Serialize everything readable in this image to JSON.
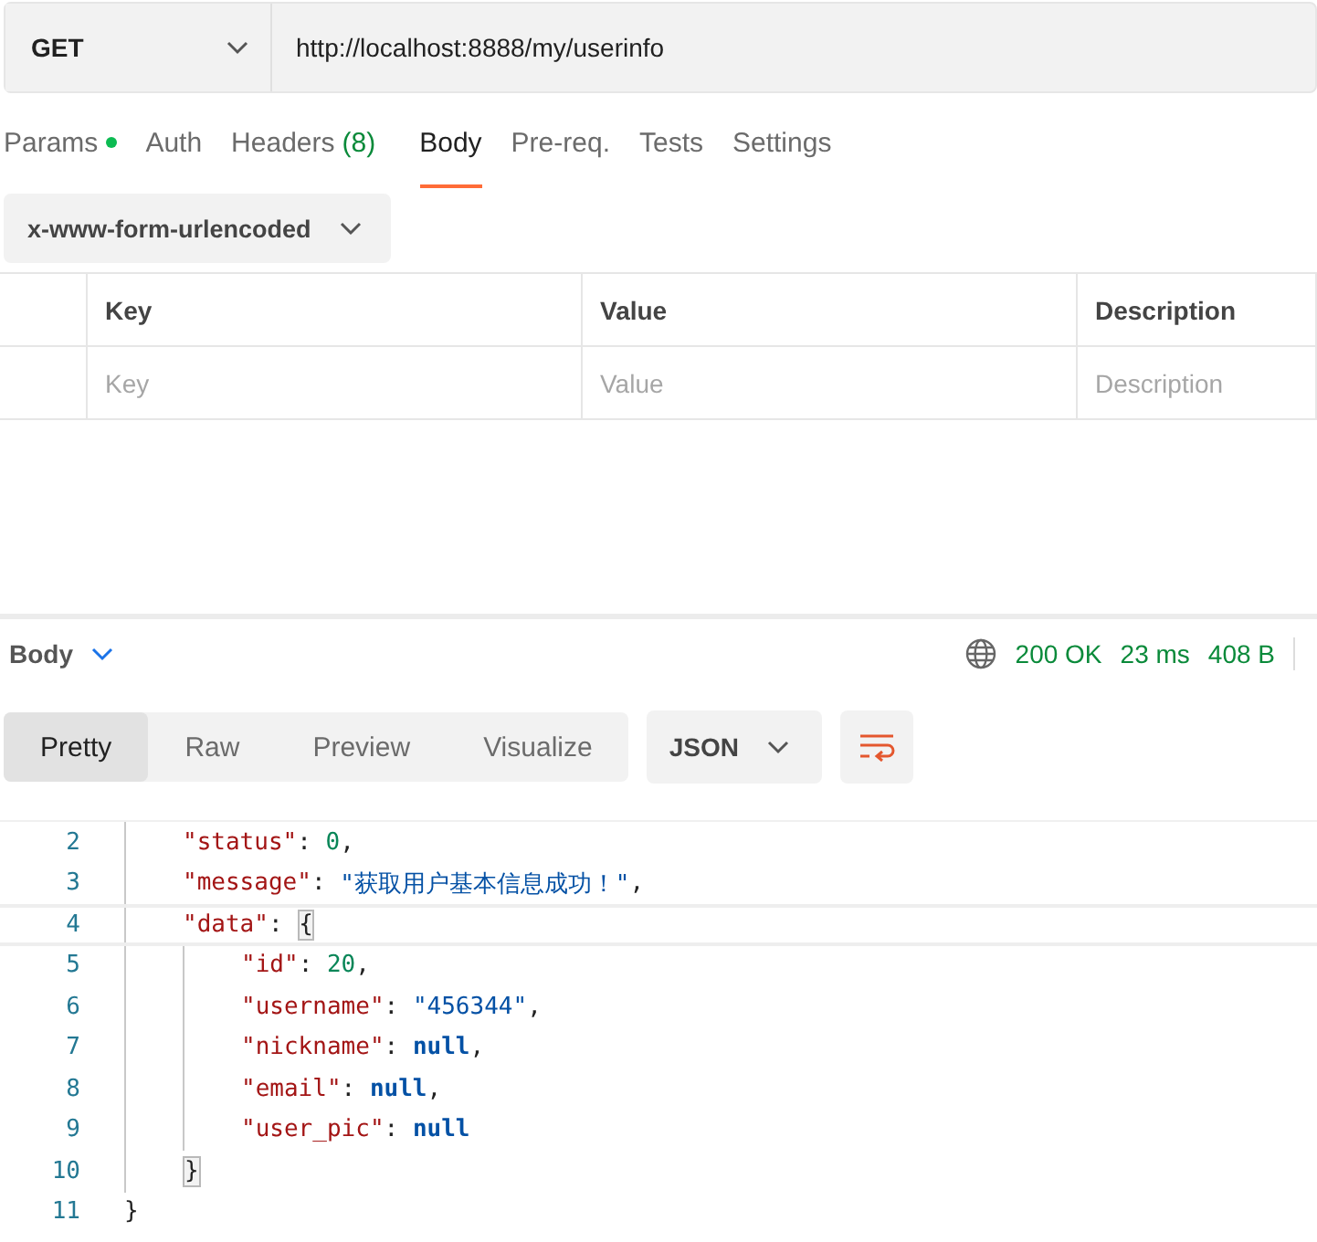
{
  "request": {
    "method": "GET",
    "url": "http://localhost:8888/my/userinfo"
  },
  "tabs": [
    {
      "label": "Params",
      "selected": false,
      "dot": true
    },
    {
      "label": "Auth",
      "selected": false,
      "dot": false
    },
    {
      "label": "Headers",
      "count": "(8)",
      "selected": false,
      "dot": false
    },
    {
      "label": "Body",
      "selected": true,
      "dot": false
    },
    {
      "label": "Pre-req.",
      "selected": false,
      "dot": false
    },
    {
      "label": "Tests",
      "selected": false,
      "dot": false
    },
    {
      "label": "Settings",
      "selected": false,
      "dot": false
    }
  ],
  "body_type": "x-www-form-urlencoded",
  "table": {
    "columns": [
      "Key",
      "Value",
      "Description"
    ],
    "placeholders": [
      "Key",
      "Value",
      "Description"
    ]
  },
  "response": {
    "title": "Body",
    "status": "200 OK",
    "time": "23 ms",
    "size": "408 B",
    "views": [
      {
        "label": "Pretty",
        "selected": true
      },
      {
        "label": "Raw",
        "selected": false
      },
      {
        "label": "Preview",
        "selected": false
      },
      {
        "label": "Visualize",
        "selected": false
      }
    ],
    "format": "JSON"
  },
  "code": {
    "body": [
      {
        "number": "2",
        "highlighted": false,
        "tokens": [
          {
            "kind": "key",
            "text": "\"status\""
          },
          {
            "kind": "punct",
            "text": ": "
          },
          {
            "kind": "number",
            "text": "0"
          },
          {
            "kind": "punct",
            "text": ","
          }
        ]
      },
      {
        "number": "3",
        "highlighted": false,
        "tokens": [
          {
            "kind": "key",
            "text": "\"message\""
          },
          {
            "kind": "punct",
            "text": ": "
          },
          {
            "kind": "string",
            "text": "\"获取用户基本信息成功！\""
          },
          {
            "kind": "punct",
            "text": ","
          }
        ]
      },
      {
        "number": "4",
        "highlighted": true,
        "tokens": [
          {
            "kind": "key",
            "text": "\"data\""
          },
          {
            "kind": "punct",
            "text": ": "
          },
          {
            "kind": "bracket",
            "text": "{"
          }
        ],
        "children": [
          {
            "number": "5",
            "highlighted": false,
            "tokens": [
              {
                "kind": "key",
                "text": "\"id\""
              },
              {
                "kind": "punct",
                "text": ": "
              },
              {
                "kind": "number",
                "text": "20"
              },
              {
                "kind": "punct",
                "text": ","
              }
            ]
          },
          {
            "number": "6",
            "highlighted": false,
            "tokens": [
              {
                "kind": "key",
                "text": "\"username\""
              },
              {
                "kind": "punct",
                "text": ": "
              },
              {
                "kind": "string",
                "text": "\"456344\""
              },
              {
                "kind": "punct",
                "text": ","
              }
            ]
          },
          {
            "number": "7",
            "highlighted": false,
            "tokens": [
              {
                "kind": "key",
                "text": "\"nickname\""
              },
              {
                "kind": "punct",
                "text": ": "
              },
              {
                "kind": "null",
                "text": "null"
              },
              {
                "kind": "punct",
                "text": ","
              }
            ]
          },
          {
            "number": "8",
            "highlighted": false,
            "tokens": [
              {
                "kind": "key",
                "text": "\"email\""
              },
              {
                "kind": "punct",
                "text": ": "
              },
              {
                "kind": "null",
                "text": "null"
              },
              {
                "kind": "punct",
                "text": ","
              }
            ]
          },
          {
            "number": "9",
            "highlighted": false,
            "tokens": [
              {
                "kind": "key",
                "text": "\"user_pic\""
              },
              {
                "kind": "punct",
                "text": ": "
              },
              {
                "kind": "null",
                "text": "null"
              }
            ]
          }
        ]
      },
      {
        "number": "10",
        "highlighted": false,
        "tokens": [
          {
            "kind": "bracket",
            "text": "}"
          }
        ]
      }
    ],
    "after": [
      {
        "number": "11",
        "highlighted": false,
        "tokens": [
          {
            "kind": "punct",
            "text": "}"
          }
        ]
      }
    ]
  }
}
